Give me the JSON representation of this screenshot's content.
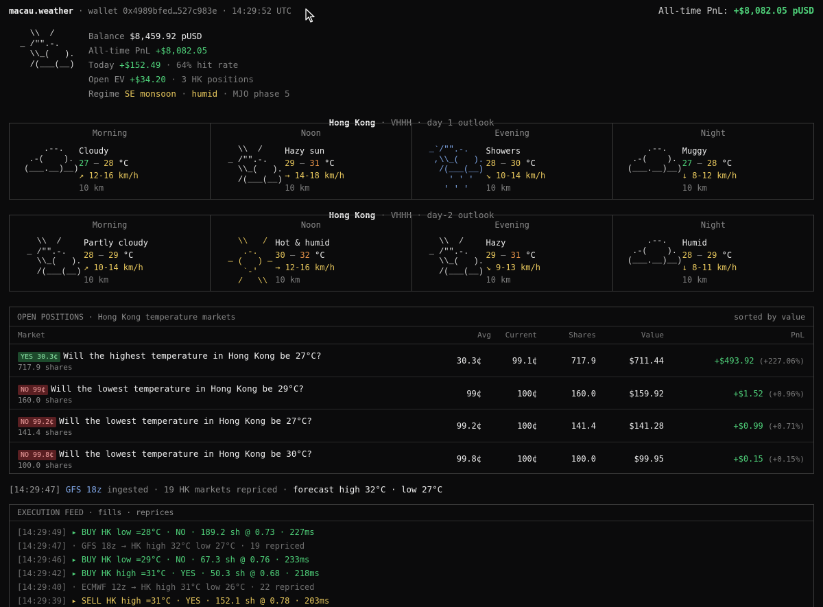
{
  "topbar": {
    "brand": "macau.weather",
    "meta": "· wallet 0x4989bfed…527c983e · 14:29:52 UTC",
    "pnl_label": "All-time PnL:",
    "pnl_value": "+$8,082.05 pUSD"
  },
  "account": {
    "balance_label": "Balance",
    "balance_value": "$8,459.92 pUSD",
    "alltime_label": "All-time PnL",
    "alltime_value": "+$8,082.05",
    "today_label": "Today",
    "today_value": "+$152.49",
    "today_rest": "· 64% hit rate",
    "openev_label": "Open EV",
    "openev_value": "+$34.20",
    "openev_rest": "· 3 HK positions",
    "regime_label": "Regime",
    "regime_monsoon": "SE monsoon",
    "regime_sep": "·",
    "regime_humid": "humid",
    "regime_rest": "· MJO phase 5"
  },
  "day1": {
    "city": "Hong Kong",
    "rest": "· VHHH · day-1 outlook",
    "cells": [
      {
        "tod": "Morning",
        "cond": "Cloudy",
        "lo": "27",
        "hi": "28",
        "unit": "°C",
        "wind": "↗ 12-16 km/h",
        "vis": "10 km"
      },
      {
        "tod": "Noon",
        "cond": "Hazy sun",
        "lo": "29",
        "hi": "31",
        "unit": "°C",
        "wind": "→ 14-18 km/h",
        "vis": "10 km"
      },
      {
        "tod": "Evening",
        "cond": "Showers",
        "lo": "28",
        "hi": "30",
        "unit": "°C",
        "wind": "↘ 10-14 km/h",
        "vis": "10 km"
      },
      {
        "tod": "Night",
        "cond": "Muggy",
        "lo": "27",
        "hi": "28",
        "unit": "°C",
        "wind": "↓ 8-12 km/h",
        "vis": "10 km"
      }
    ]
  },
  "day2": {
    "city": "Hong Kong",
    "rest": "· VHHH · day-2 outlook",
    "cells": [
      {
        "tod": "Morning",
        "cond": "Partly cloudy",
        "lo": "28",
        "hi": "29",
        "unit": "°C",
        "wind": "↗ 10-14 km/h",
        "vis": "10 km"
      },
      {
        "tod": "Noon",
        "cond": "Hot & humid",
        "lo": "30",
        "hi": "32",
        "unit": "°C",
        "wind": "→ 12-16 km/h",
        "vis": "10 km"
      },
      {
        "tod": "Evening",
        "cond": "Hazy",
        "lo": "29",
        "hi": "31",
        "unit": "°C",
        "wind": "↘ 9-13 km/h",
        "vis": "10 km"
      },
      {
        "tod": "Night",
        "cond": "Humid",
        "lo": "28",
        "hi": "29",
        "unit": "°C",
        "wind": "↓ 8-11 km/h",
        "vis": "10 km"
      }
    ]
  },
  "positions": {
    "title": "OPEN POSITIONS · Hong Kong temperature markets",
    "sort": "sorted by value",
    "columns": {
      "market": "Market",
      "avg": "Avg",
      "current": "Current",
      "shares": "Shares",
      "value": "Value",
      "pnl": "PnL"
    },
    "rows": [
      {
        "badge": "YES 30.3¢",
        "side": "yes",
        "question": "Will the highest temperature in Hong Kong be 27°C?",
        "sub": "717.9 shares",
        "avg": "30.3¢",
        "current": "99.1¢",
        "shares": "717.9",
        "value": "$711.44",
        "pnl": "+$493.92",
        "pct": "(+227.06%)"
      },
      {
        "badge": "NO 99¢",
        "side": "no",
        "question": "Will the lowest temperature in Hong Kong be 29°C?",
        "sub": "160.0 shares",
        "avg": "99¢",
        "current": "100¢",
        "shares": "160.0",
        "value": "$159.92",
        "pnl": "+$1.52",
        "pct": "(+0.96%)"
      },
      {
        "badge": "NO 99.2¢",
        "side": "no",
        "question": "Will the lowest temperature in Hong Kong be 27°C?",
        "sub": "141.4 shares",
        "avg": "99.2¢",
        "current": "100¢",
        "shares": "141.4",
        "value": "$141.28",
        "pnl": "+$0.99",
        "pct": "(+0.71%)"
      },
      {
        "badge": "NO 99.8¢",
        "side": "no",
        "question": "Will the lowest temperature in Hong Kong be 30°C?",
        "sub": "100.0 shares",
        "avg": "99.8¢",
        "current": "100¢",
        "shares": "100.0",
        "value": "$99.95",
        "pnl": "+$0.15",
        "pct": "(+0.15%)"
      }
    ]
  },
  "ingest": {
    "ts": "[14:29:47]",
    "model": "GFS 18z",
    "mid": "ingested · 19 HK markets repriced ·",
    "forecast": "forecast high 32°C · low 27°C"
  },
  "feed": {
    "title": "EXECUTION FEED · fills · reprices",
    "lines": [
      {
        "ts": "[14:29:49]",
        "kind": "buy",
        "text": "▸ BUY HK low =28°C · NO · 189.2 sh @ 0.73 · 227ms"
      },
      {
        "ts": "[14:29:47]",
        "kind": "info",
        "text": "· GFS 18z → HK high 32°C low 27°C · 19 repriced"
      },
      {
        "ts": "[14:29:46]",
        "kind": "buy",
        "text": "▸ BUY HK low =29°C · NO · 67.3 sh @ 0.76 · 233ms"
      },
      {
        "ts": "[14:29:42]",
        "kind": "buy",
        "text": "▸ BUY HK high =31°C · YES · 50.3 sh @ 0.68 · 218ms"
      },
      {
        "ts": "[14:29:40]",
        "kind": "info",
        "text": "· ECMWF 12z → HK high 31°C low 26°C · 22 repriced"
      },
      {
        "ts": "[14:29:39]",
        "kind": "sell",
        "text": "▸ SELL HK high =31°C · YES · 152.1 sh @ 0.78 · 203ms"
      }
    ]
  }
}
